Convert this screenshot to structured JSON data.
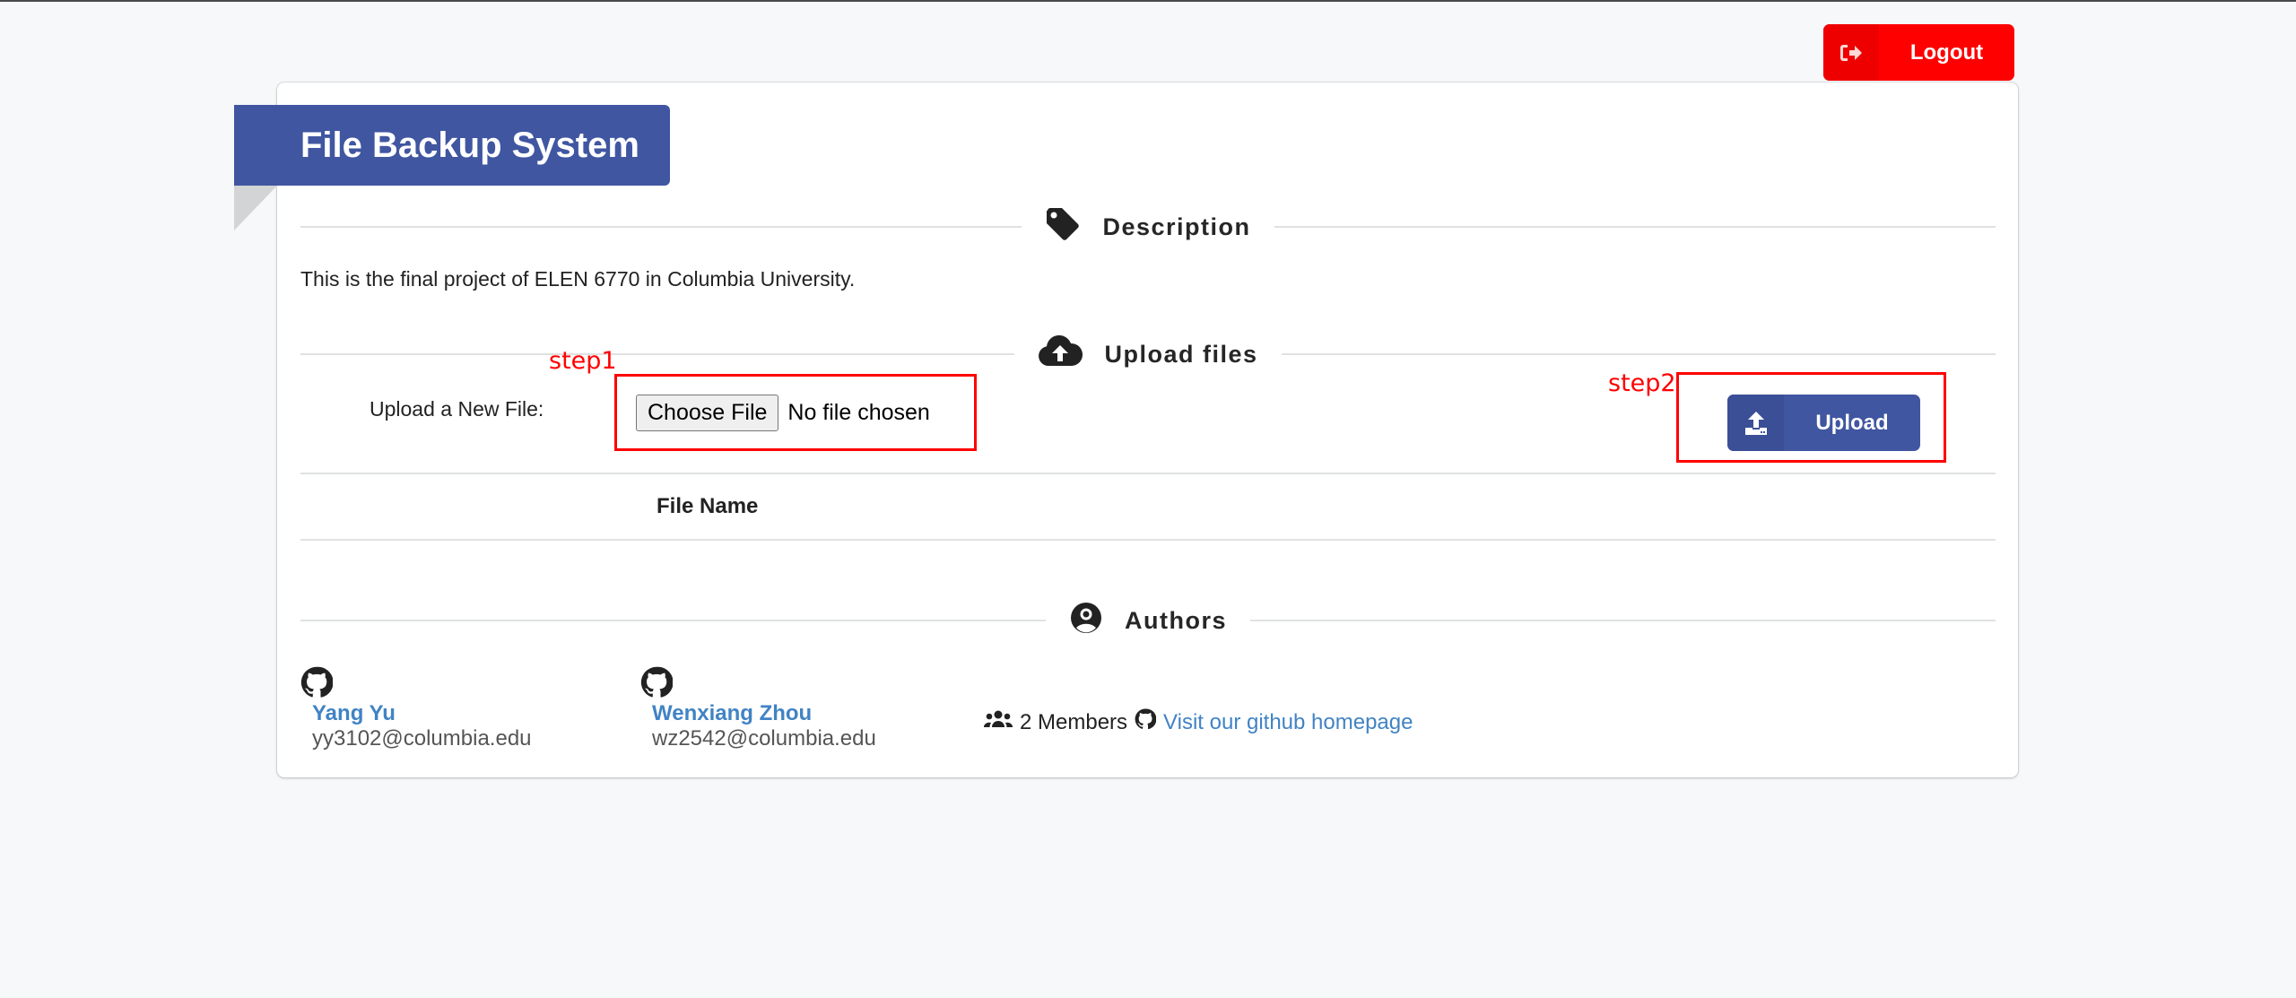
{
  "header": {
    "logout_label": "Logout",
    "logout_icon": "sign-out-icon"
  },
  "card": {
    "title": "File Backup System",
    "sections": {
      "description": {
        "heading": "Description",
        "icon": "tag-icon",
        "text": "This is the final project of ELEN 6770 in Columbia University."
      },
      "upload": {
        "heading": "Upload files",
        "icon": "cloud-upload-icon",
        "field_label": "Upload a New File:",
        "choose_button": "Choose File",
        "file_status": "No file chosen",
        "upload_button": "Upload",
        "upload_icon": "upload-icon"
      },
      "files_table": {
        "columns": [
          "File Name"
        ],
        "rows": []
      },
      "authors": {
        "heading": "Authors",
        "icon": "user-circle-icon",
        "people": [
          {
            "name": "Yang Yu",
            "email": "yy3102@columbia.edu"
          },
          {
            "name": "Wenxiang Zhou",
            "email": "wz2542@columbia.edu"
          }
        ],
        "members_count": "2 Members",
        "github_link": "Visit our github homepage"
      }
    }
  },
  "annotations": [
    {
      "label": "step1",
      "color": "#ff0000"
    },
    {
      "label": "step2",
      "color": "#ff0000"
    }
  ],
  "colors": {
    "primary": "#4056a1",
    "danger": "#ff0000",
    "link": "#4183c4",
    "background": "#f7f8fa"
  }
}
